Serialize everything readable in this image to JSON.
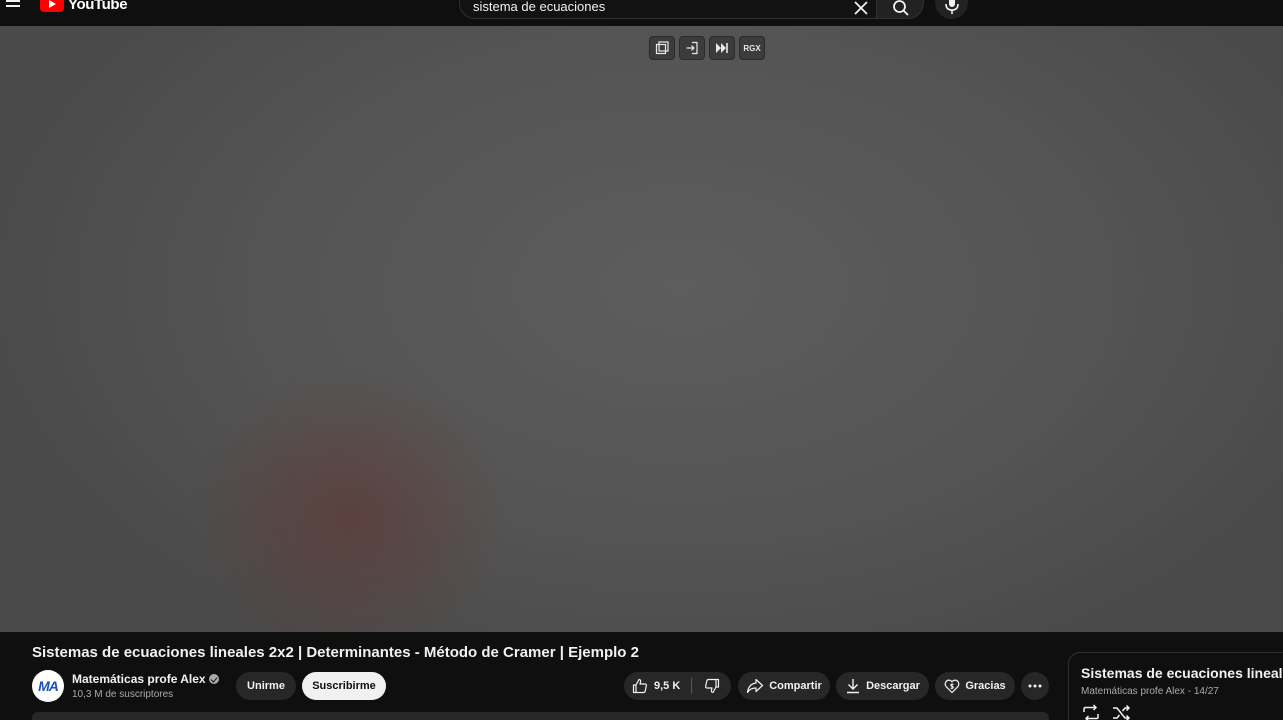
{
  "header": {
    "logo_text": "YouTube",
    "search_query": "sistema de ecuaciones"
  },
  "player": {
    "tools": [
      {
        "icon": "picture-in-picture-icon"
      },
      {
        "icon": "enter-icon"
      },
      {
        "icon": "skip-next-icon"
      },
      {
        "label": "RGX"
      }
    ]
  },
  "video": {
    "title": "Sistemas de ecuaciones lineales 2x2 | Determinantes - Método de Cramer | Ejemplo 2"
  },
  "channel": {
    "avatar_initials": "MA",
    "name": "Matemáticas profe Alex",
    "subscribers": "10,3 M de suscriptores",
    "join_label": "Unirme",
    "subscribe_label": "Suscribirme"
  },
  "actions": {
    "like_count": "9,5 K",
    "share_label": "Compartir",
    "download_label": "Descargar",
    "thanks_label": "Gracias"
  },
  "playlist": {
    "title": "Sistemas de ecuaciones lineales",
    "meta": "Matemáticas profe Alex - 14/27"
  },
  "colors": {
    "background": "#0f0f0f",
    "brand_red": "#ff0000",
    "pill": "#272727",
    "subscribe_bg": "#f1f1f1"
  }
}
